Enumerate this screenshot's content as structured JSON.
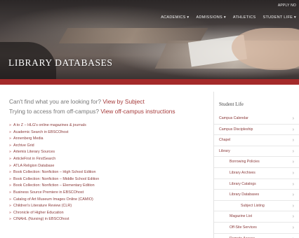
{
  "header": {
    "top_link": "APPLY NO",
    "nav": [
      "ACADEMICS ▾",
      "ADMISSIONS ▾",
      "ATHLETICS",
      "STUDENT LIFE ▾"
    ],
    "title": "LIBRARY DATABASES"
  },
  "intro": {
    "line1_prefix": "Can't find what you are looking for?",
    "line1_link": "View by Subject",
    "line2_prefix": "Trying to access from off-campus?",
    "line2_link": "View off-campus instructions"
  },
  "databases": [
    "A to Z – HLG's online magazines & journals",
    "Academic Search in EBSCOhost",
    "Annenberg Media",
    "Archive Grid",
    "Artemis Literary Sources",
    "ArticleFirst in FirstSearch",
    "ATLA Religion Database",
    "Book Collection: Nonfiction – High School Edition",
    "Book Collection: Nonfiction – Middle School Edition",
    "Book Collection: Nonfiction – Elementary Edition",
    "Business Source Premiere in EBSCOhost",
    "Catalog of Art Museum Images Online (CAMIO)",
    "Children's Literature Review (CLR)",
    "Chronicle of Higher Education",
    "CINAHL (Nursing) in EBSCOhost"
  ],
  "sidebar": {
    "heading": "Student Life",
    "items": [
      {
        "label": "Campus Calendar",
        "indent": 0
      },
      {
        "label": "Campus Discipleship",
        "indent": 0
      },
      {
        "label": "Chapel",
        "indent": 0
      },
      {
        "label": "Library",
        "indent": 0
      },
      {
        "label": "Borrowing Policies",
        "indent": 1
      },
      {
        "label": "Library Archives",
        "indent": 1
      },
      {
        "label": "Library Catalogs",
        "indent": 1
      },
      {
        "label": "Library Databases",
        "indent": 1
      },
      {
        "label": "Subject Listing",
        "indent": 2
      },
      {
        "label": "Magazine List",
        "indent": 1
      },
      {
        "label": "Off-Site Services",
        "indent": 1
      },
      {
        "label": "Remote Access",
        "indent": 1
      }
    ],
    "chevron": "›"
  },
  "colors": {
    "accent": "#a42a2a",
    "link": "#8a3a3a"
  }
}
